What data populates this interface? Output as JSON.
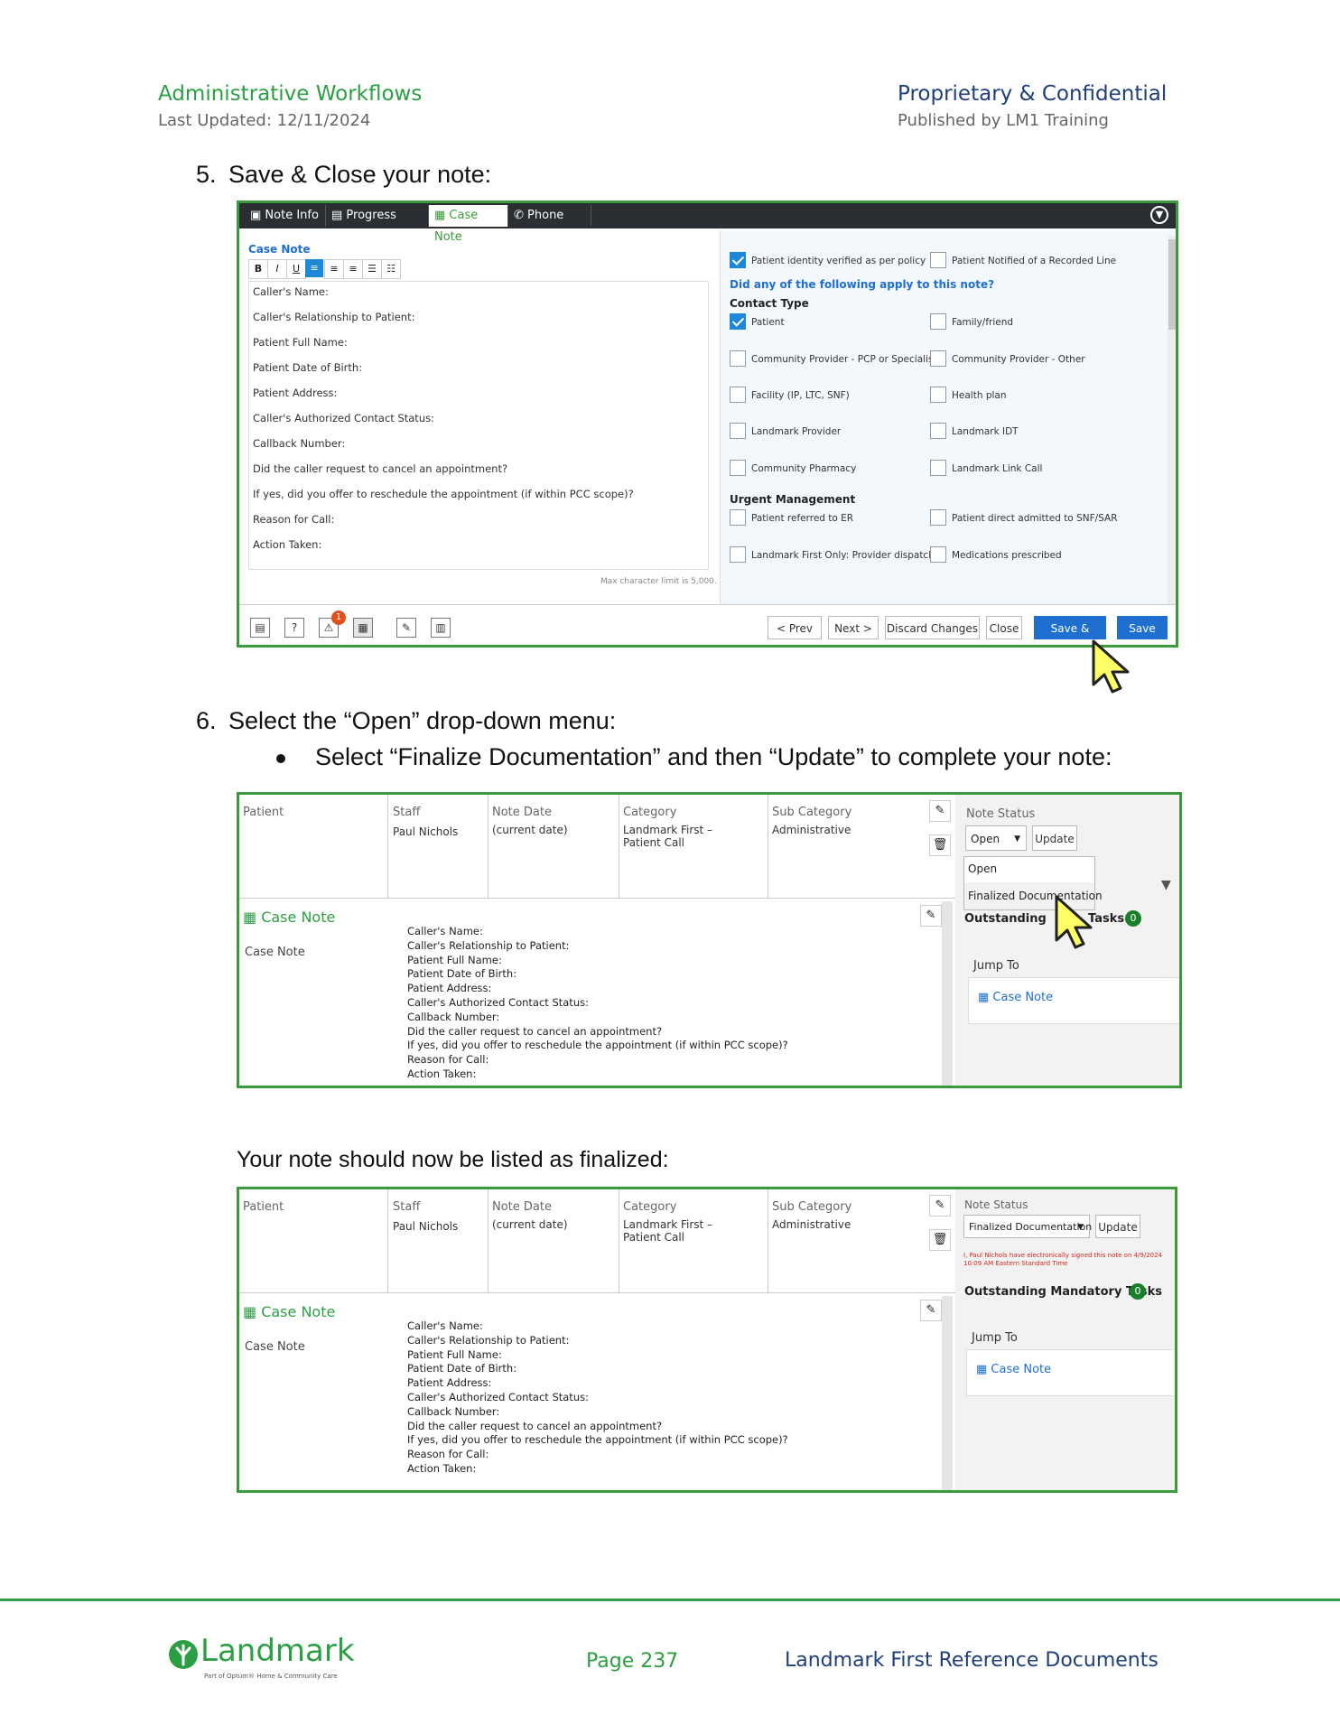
{
  "header": {
    "left_title": "Administrative Workflows",
    "left_sub": "Last Updated: 12/11/2024",
    "right_title": "Proprietary & Confidential",
    "right_sub": "Published by LM1 Training"
  },
  "steps": {
    "step5": "5. Save & Close your note:",
    "step6": "6. Select the “Open” drop-down menu:",
    "bullet": "Select “Finalize Documentation” and then “Update” to complete your note:",
    "after": "Your note should now be listed as finalized:"
  },
  "editor": {
    "tabs": [
      "Note Info",
      "Progress Note",
      "Case Note",
      "Phone Call"
    ],
    "section_title": "Case Note",
    "format_buttons": [
      "B",
      "I",
      "U"
    ],
    "lines": [
      "Caller's Name:",
      "Caller's Relationship to Patient:",
      "Patient Full Name:",
      "Patient Date of Birth:",
      "Patient Address:",
      "Caller's Authorized Contact Status:",
      "Callback Number:",
      "Did the caller request to cancel an appointment?",
      "If yes, did you offer to reschedule the appointment (if within PCC scope)?",
      "Reason for Call:",
      "Action Taken:"
    ],
    "max_chars": "Max character limit is 5,000.",
    "identity_verified": "Patient identity verified as per policy",
    "recorded_line": "Patient Notified of a Recorded Line",
    "question": "Did any of the following apply to this note?",
    "contact_type_title": "Contact Type",
    "contact_types": [
      {
        "label": "Patient",
        "checked": true
      },
      {
        "label": "Family/friend",
        "checked": false
      },
      {
        "label": "Community Provider - PCP or Specialist",
        "checked": false
      },
      {
        "label": "Community Provider - Other",
        "checked": false
      },
      {
        "label": "Facility (IP, LTC, SNF)",
        "checked": false
      },
      {
        "label": "Health plan",
        "checked": false
      },
      {
        "label": "Landmark Provider",
        "checked": false
      },
      {
        "label": "Landmark IDT",
        "checked": false
      },
      {
        "label": "Community Pharmacy",
        "checked": false
      },
      {
        "label": "Landmark Link Call",
        "checked": false
      }
    ],
    "urgent_title": "Urgent Management",
    "urgent_items": [
      {
        "label": "Patient referred to ER",
        "checked": false
      },
      {
        "label": "Patient direct admitted to SNF/SAR",
        "checked": false
      },
      {
        "label": "Landmark First Only: Provider dispatched",
        "checked": false
      },
      {
        "label": "Medications prescribed",
        "checked": false
      }
    ],
    "badge_count": "1",
    "buttons": {
      "prev": "< Prev",
      "next": "Next >",
      "discard": "Discard Changes",
      "close": "Close",
      "save_close": "Save & Close",
      "save": "Save"
    }
  },
  "note_view": {
    "columns": {
      "patient": "Patient",
      "staff": "Staff",
      "note_date": "Note Date",
      "category": "Category",
      "sub_category": "Sub Category"
    },
    "values": {
      "staff": "Paul Nichols",
      "note_date": "(current date)",
      "category": "Landmark First – Patient Call",
      "sub_category": "Administrative"
    },
    "case_note_heading": "Case Note",
    "case_note_label": "Case Note",
    "body": "Caller's Name:\nCaller's Relationship to Patient:\nPatient Full Name:\nPatient Date of Birth:\nPatient Address:\nCaller's Authorized Contact Status:\nCallback Number:\nDid the caller request to cancel an appointment?\nIf yes, did you offer to reschedule the appointment (if within PCC scope)?\nReason for Call:\nAction Taken:",
    "note_status_label": "Note Status",
    "update": "Update",
    "outstanding_prefix": "Outstanding",
    "outstanding_tasks_suffix": "Tasks",
    "outstanding_full": "Outstanding Mandatory Tasks",
    "tasks_count": "0",
    "jump_to": "Jump To",
    "jump_link": "Case Note"
  },
  "open_view": {
    "status_value": "Open",
    "dropdown_options": [
      "Open",
      "Finalized Documentation"
    ]
  },
  "finalized_view": {
    "status_value": "Finalized Documentation",
    "signed_text": "I, Paul Nichols have electronically signed this note on 4/9/2024 10:09 AM Eastern Standard Time"
  },
  "footer": {
    "logo_text": "Landmark",
    "logo_sub": "Part of Optum® Home & Community Care",
    "page": "Page 237",
    "doc_title": "Landmark First Reference Documents"
  },
  "colors": {
    "brand_green": "#2c9f44",
    "frame_green": "#3c9a3c",
    "primary_blue": "#1e6fd0",
    "header_blue": "#1f3f7a"
  }
}
